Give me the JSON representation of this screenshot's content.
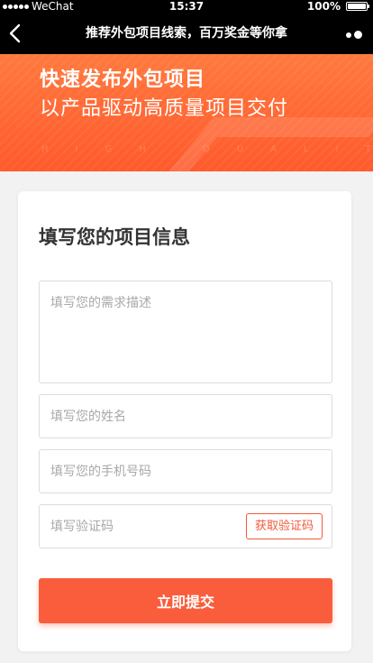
{
  "status_bar": {
    "carrier": "WeChat",
    "time": "15:37",
    "battery_text": "100%",
    "battery_level": 1.0
  },
  "nav": {
    "title": "推荐外包项目线索，百万奖金等你拿",
    "back_icon": "chevron-left-icon",
    "more_icon": "more-dots-icon"
  },
  "banner": {
    "line1": "快速发布外包项目",
    "line2": "以产品驱动高质量项目交付",
    "watermark": "HIGH QUALITY",
    "color": "#ff6a35"
  },
  "form": {
    "title": "填写您的项目信息",
    "description_placeholder": "填写您的需求描述",
    "name_placeholder": "填写您的姓名",
    "phone_placeholder": "填写您的手机号码",
    "code_placeholder": "填写验证码",
    "get_code_label": "获取验证码",
    "submit_label": "立即提交",
    "accent_color": "#f95d3b"
  }
}
